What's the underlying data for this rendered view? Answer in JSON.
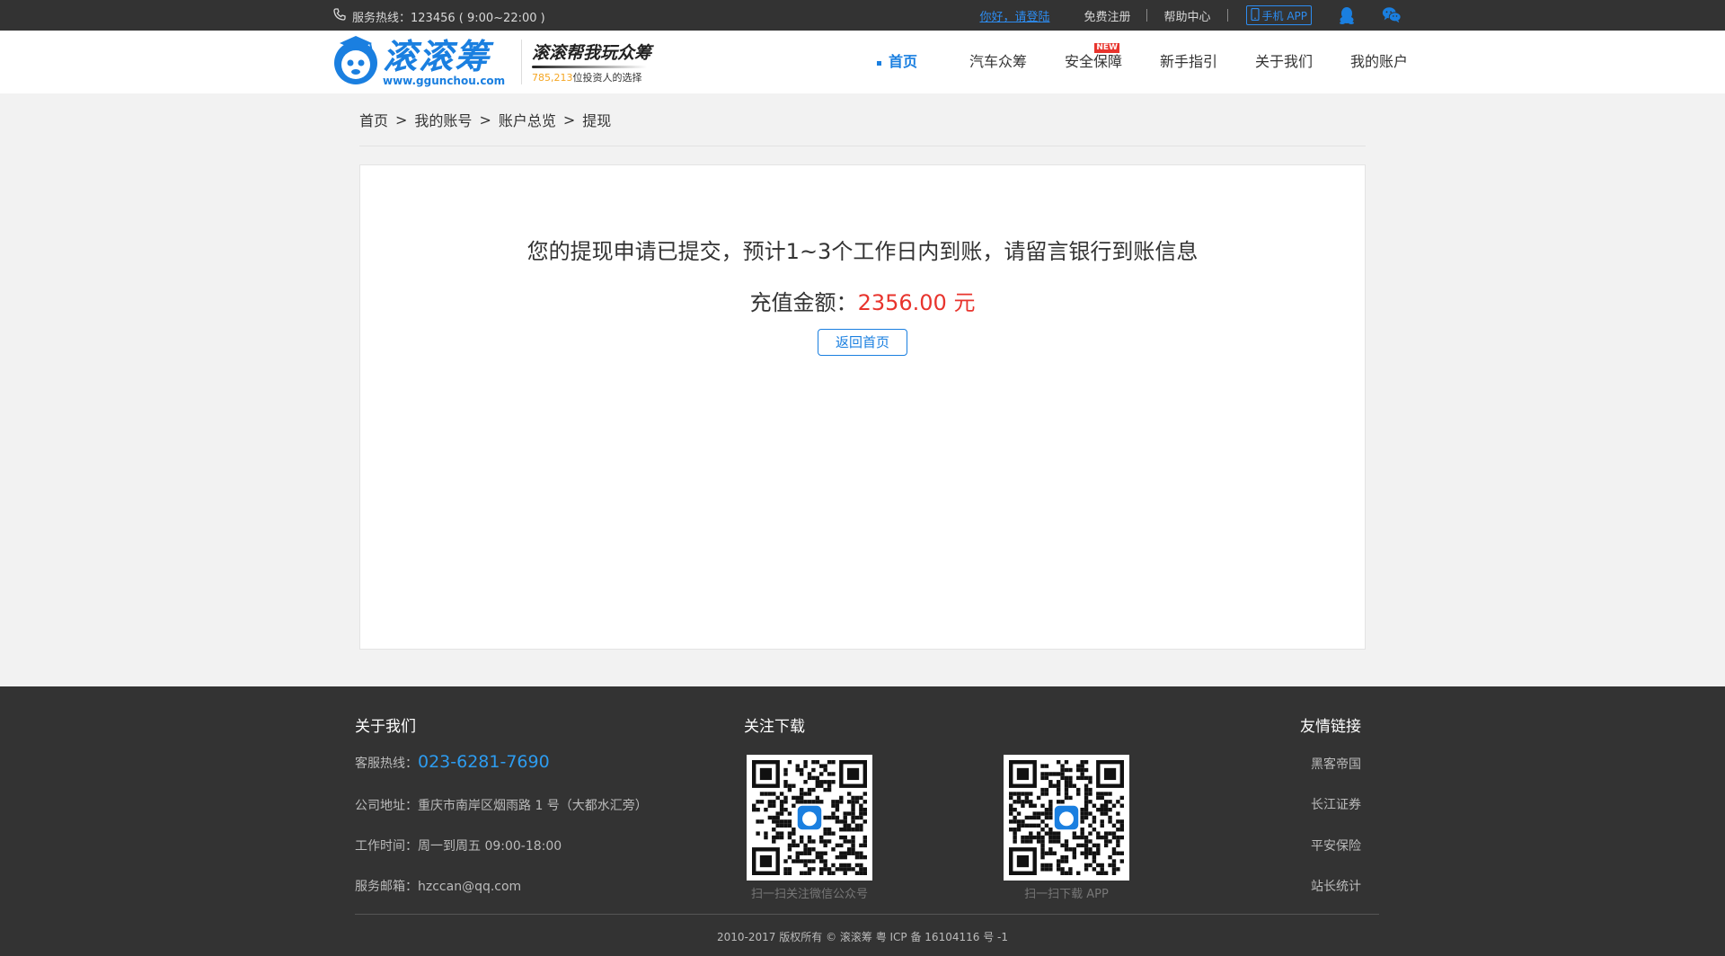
{
  "topbar": {
    "hotline": "服务热线：123456 ( 9:00~22:00 )",
    "login": "你好，请登陆",
    "register": "免费注册",
    "help": "帮助中心",
    "app": "手机 APP"
  },
  "header": {
    "logo_name": "滚滚筹",
    "logo_url": "www.ggunchou.com",
    "slogan": "滚滚帮我玩众筹",
    "slogan_count": "785,213",
    "slogan_sub": "位投资人的选择",
    "nav": [
      "首页",
      "汽车众筹",
      "安全保障",
      "新手指引",
      "关于我们",
      "我的账户"
    ],
    "new_badge": "NEW"
  },
  "breadcrumb": [
    "首页",
    "我的账号",
    "账户总览",
    "提现"
  ],
  "breadcrumb_sep": ">",
  "result": {
    "message": "您的提现申请已提交，预计1~3个工作日内到账，请留言银行到账信息",
    "amount_label": "充值金额：",
    "amount_value": "2356.00 元",
    "back_button": "返回首页"
  },
  "footer": {
    "about_title": "关于我们",
    "hotline_label": "客服热线：",
    "hotline_value": "023-6281-7690",
    "address": "公司地址：重庆市南岸区烟雨路 1 号（大都水汇旁）",
    "hours": "工作时间：周一到周五  09:00-18:00",
    "email": "服务邮箱：hzccan@qq.com",
    "follow_title": "关注下载",
    "qr1_caption": "扫一扫关注微信公众号",
    "qr2_caption": "扫一扫下载 APP",
    "links_title": "友情链接",
    "links": [
      "黑客帝国",
      "长江证券",
      "平安保险",
      "站长统计"
    ],
    "copyright": "2010-2017 版权所有 © 滚滚筹 粤 ICP 备 16104116 号 -1"
  },
  "colors": {
    "accent": "#1a7fe0",
    "amount": "#e8342d",
    "footer_bg": "#333333",
    "phone": "#2d9cf0"
  }
}
